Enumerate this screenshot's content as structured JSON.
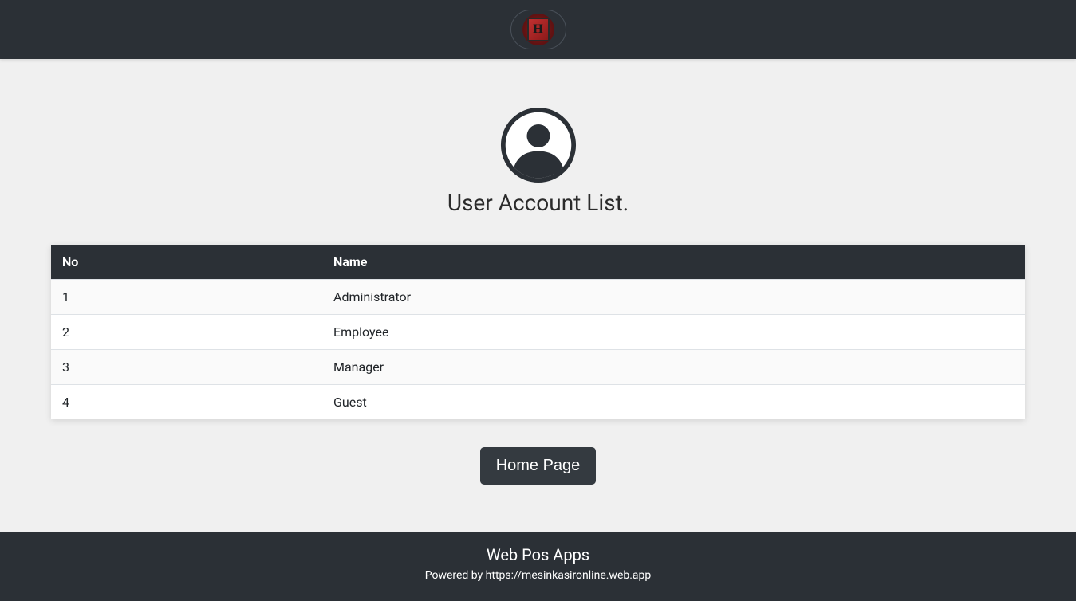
{
  "header": {
    "logo_letter": "H"
  },
  "page": {
    "title": "User Account List."
  },
  "table": {
    "headers": {
      "no": "No",
      "name": "Name"
    },
    "rows": [
      {
        "no": "1",
        "name": "Administrator"
      },
      {
        "no": "2",
        "name": "Employee"
      },
      {
        "no": "3",
        "name": "Manager"
      },
      {
        "no": "4",
        "name": "Guest"
      }
    ]
  },
  "buttons": {
    "home": "Home Page"
  },
  "footer": {
    "title": "Web Pos Apps",
    "powered_by": "Powered by https://mesinkasironline.web.app"
  }
}
